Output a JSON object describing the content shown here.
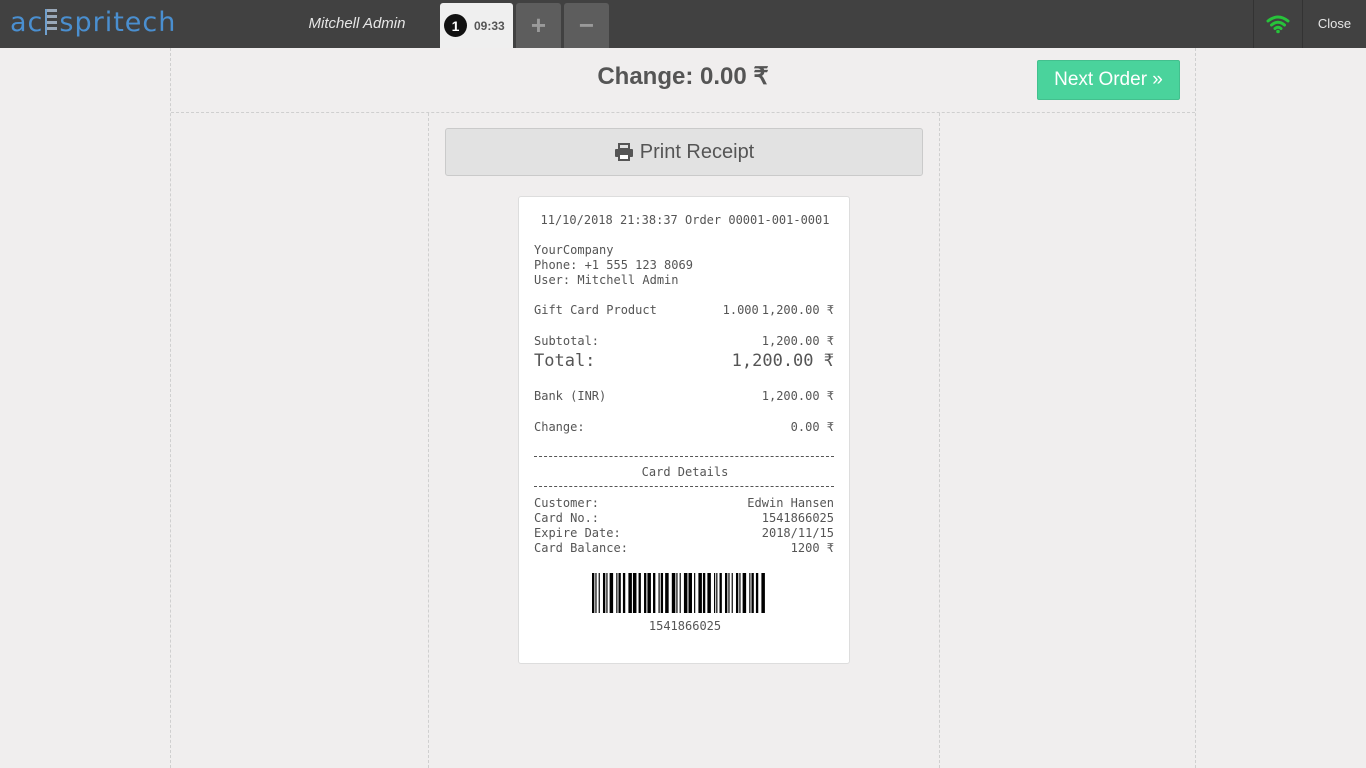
{
  "header": {
    "logo_prefix": "ac",
    "logo_suffix": "spritech",
    "user": "Mitchell Admin",
    "order_tab": {
      "number": "1",
      "time": "09:33"
    },
    "add_label": "+",
    "remove_label": "−",
    "close_label": "Close",
    "wifi_color": "#27c33a"
  },
  "screen": {
    "change_title": "Change: 0.00 ₹",
    "next_order_label": "Next Order »",
    "print_receipt_label": "Print Receipt"
  },
  "receipt": {
    "header_line": "11/10/2018 21:38:37 Order 00001-001-0001",
    "company": "YourCompany",
    "phone": "Phone: +1 555 123 8069",
    "user": "User: Mitchell Admin",
    "product": {
      "name": "Gift Card Product",
      "qty": "1.000",
      "price": "1,200.00 ₹"
    },
    "subtotal_label": "Subtotal:",
    "subtotal_value": "1,200.00 ₹",
    "total_label": "Total:",
    "total_value": "1,200.00 ₹",
    "payment_label": "Bank (INR)",
    "payment_value": "1,200.00 ₹",
    "change_label": "Change:",
    "change_value": "0.00 ₹",
    "card_details_title": "Card Details",
    "customer_label": "Customer:",
    "customer_value": "Edwin Hansen",
    "card_no_label": "Card No.:",
    "card_no_value": "1541866025",
    "expire_label": "Expire Date:",
    "expire_value": "2018/11/15",
    "balance_label": "Card Balance:",
    "balance_value": "1200 ₹",
    "barcode_text": "1541866025"
  }
}
